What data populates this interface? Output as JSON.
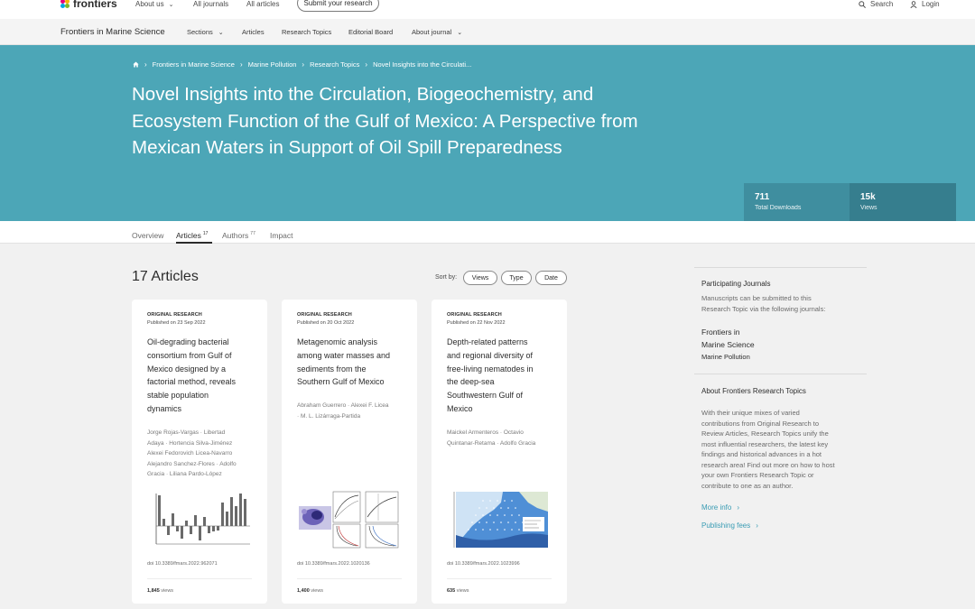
{
  "topbar": {
    "logo": "frontiers",
    "about_us": "About us",
    "all_journals": "All journals",
    "all_articles": "All articles",
    "submit": "Submit your research",
    "search": "Search",
    "login": "Login"
  },
  "journalbar": {
    "journal_name": "Frontiers in Marine Science",
    "sections": "Sections",
    "articles": "Articles",
    "research_topics": "Research Topics",
    "editorial_board": "Editorial Board",
    "about_journal": "About journal"
  },
  "hero": {
    "breadcrumb": [
      "Frontiers in Marine Science",
      "Marine Pollution",
      "Research Topics",
      "Novel Insights into the Circulati..."
    ],
    "title_lines": [
      "Novel Insights into the Circulation, Biogeochemistry, and",
      "Ecosystem Function of the Gulf of Mexico: A Perspective from",
      "Mexican Waters in Support of Oil Spill Preparedness"
    ],
    "downloads_value": "711",
    "downloads_label": "Total Downloads",
    "views_value": "15k",
    "views_label": "Views",
    "color": "#4ca6b7"
  },
  "tabs": {
    "overview": "Overview",
    "articles": "Articles",
    "articles_count": "17",
    "authors": "Authors",
    "authors_count": "77",
    "impact": "Impact"
  },
  "main": {
    "heading": "17 Articles",
    "sort_label": "Sort by:",
    "sort_views": "Views",
    "sort_type": "Type",
    "sort_date": "Date"
  },
  "cards": [
    {
      "type": "ORIGINAL RESEARCH",
      "published": "Published on 23 Sep 2022",
      "title_lines": [
        "Oil-degrading bacterial",
        "consortium from Gulf of",
        "Mexico designed by a",
        "factorial method, reveals",
        "stable population",
        "dynamics"
      ],
      "author_lines": [
        "Jorge Rojas-Vargas · Libertad",
        "Adaya · Hortencia Silva-Jiménez",
        "Alexei Fedorovich Licea-Navarro",
        "Alejandro Sanchez-Flores · Adolfo",
        "Gracia · Liliana Pardo-López"
      ],
      "doi": "doi 10.3389/fmars.2022.962071",
      "views_num": "1,845",
      "views_word": "views"
    },
    {
      "type": "ORIGINAL RESEARCH",
      "published": "Published on 20 Oct 2022",
      "title_lines": [
        "Metagenomic analysis",
        "among water masses and",
        "sediments from the",
        "Southern Gulf of Mexico"
      ],
      "author_lines": [
        "Abraham Guerrero · Alexei F. Licea",
        "· M. L. Lizárraga-Partida"
      ],
      "doi": "doi 10.3389/fmars.2022.1020136",
      "views_num": "1,400",
      "views_word": "views"
    },
    {
      "type": "ORIGINAL RESEARCH",
      "published": "Published on 22 Nov 2022",
      "title_lines": [
        "Depth-related patterns",
        "and regional diversity of",
        "free-living nematodes in",
        "the deep-sea",
        "Southwestern Gulf of",
        "Mexico"
      ],
      "author_lines": [
        "Maickel Armenteros · Octavio",
        "Quintanar-Retama · Adolfo Gracia"
      ],
      "doi": "doi 10.3389/fmars.2022.1023996",
      "views_num": "635",
      "views_word": "views"
    }
  ],
  "sidebar": {
    "participating_heading": "Participating Journals",
    "participating_text_lines": [
      "Manuscripts can be submitted to this",
      "Research Topic via the following journals:"
    ],
    "journal_lines": [
      "Frontiers in",
      "Marine Science"
    ],
    "journal_section": "Marine Pollution",
    "about_heading": "About Frontiers Research Topics",
    "about_text_lines": [
      "With their unique mixes of varied",
      "contributions from Original Research to",
      "Review Articles, Research Topics unify the",
      "most influential researchers, the latest key",
      "findings and historical advances in a hot",
      "research area! Find out more on how to host",
      "your own Frontiers Research Topic or",
      "contribute to one as an author."
    ],
    "more_info": "More info",
    "publishing_fees": "Publishing fees",
    "link_color": "#3a9cb4"
  }
}
